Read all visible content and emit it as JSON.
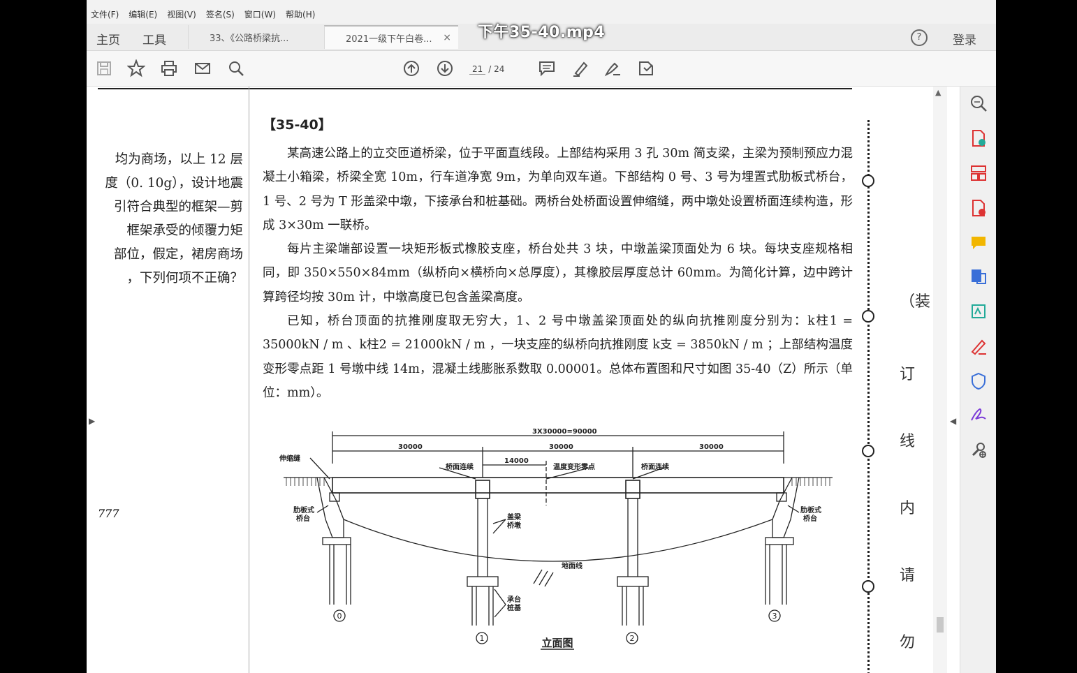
{
  "menu": [
    "文件(F)",
    "编辑(E)",
    "视图(V)",
    "签名(S)",
    "窗口(W)",
    "帮助(H)"
  ],
  "tabs": {
    "home": "主页",
    "tools": "工具",
    "doc1": "33、《公路桥梁抗...",
    "doc2": "2021一级下午白卷...",
    "close": "×"
  },
  "video_title": "下午35-40.mp4",
  "help": "?",
  "login": "登录",
  "page": {
    "current": "21",
    "total": "/ 24"
  },
  "left_page_lines": [
    "均为商场，以上 12 层",
    "度（0. 10g），设计地震",
    "引符合典型的框架—剪",
    "框架承受的倾覆力矩",
    "部位，假定，裙房商场",
    "，下列何项不正确？"
  ],
  "left_mark": "777",
  "heading": "【35-40】",
  "paragraphs": [
    "某高速公路上的立交匝道桥梁，位于平面直线段。上部结构采用 3 孔 30m 简支梁，主梁为预制预应力混凝土小箱梁，桥梁全宽 10m，行车道净宽 9m，为单向双车道。下部结构 0 号、3 号为埋置式肋板式桥台，1 号、2 号为 T 形盖梁中墩，下接承台和桩基础。两桥台处桥面设置伸缩缝，两中墩处设置桥面连续构造，形成 3×30m 一联桥。",
    "每片主梁端部设置一块矩形板式橡胶支座，桥台处共 3 块，中墩盖梁顶面处为 6 块。每块支座规格相同，即 350×550×84mm（纵桥向×横桥向×总厚度），其橡胶层厚度总计 60mm。为简化计算，边中跨计算跨径均按 30m 计，中墩高度已包含盖梁高度。",
    "已知，桥台顶面的抗推刚度取无穷大，1、2 号中墩盖梁顶面处的纵向抗推刚度分别为：k柱1 = 35000kN / m 、k柱2 = 21000kN / m ，一块支座的纵桥向抗推刚度 k支 = 3850kN / m ；上部结构温度变形零点距 1 号墩中线 14m，混凝土线膨胀系数取 0.00001。总体布置图和尺寸如图 35-40（Z）所示（单位：mm）。"
  ],
  "binding_chars": [
    "（装",
    "订",
    "线",
    "内",
    "请",
    "勿"
  ],
  "diagram": {
    "total_dim": "3X30000=90000",
    "span1": "30000",
    "span2": "30000",
    "span3": "30000",
    "dim_14000": "14000",
    "label_expansion": "伸缩缝",
    "label_cont1": "桥面连续",
    "label_cont2": "桥面连续",
    "label_zero": "温度变形零点",
    "label_cap_pier": "盖梁\n桥墩",
    "label_abut_left": "肋板式\n桥台",
    "label_abut_right": "肋板式\n桥台",
    "label_ground": "地面线",
    "label_cap_pile": "承台\n桩基",
    "pier0": "0",
    "pier1": "1",
    "pier2": "2",
    "pier3": "3",
    "caption": "立面图"
  }
}
